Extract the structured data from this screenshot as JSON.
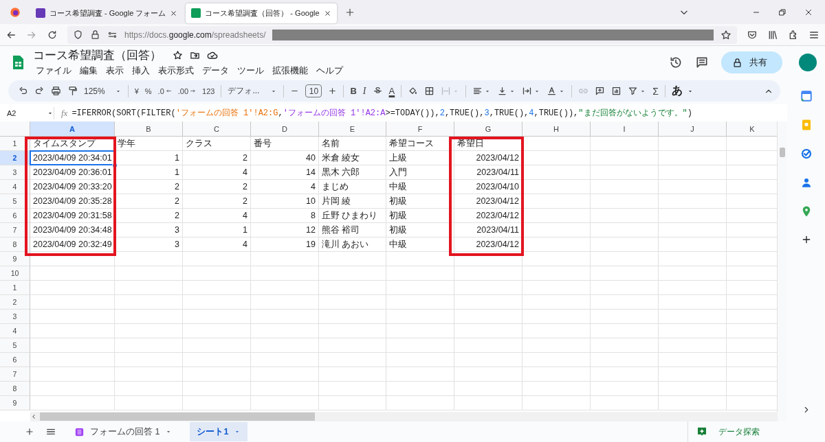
{
  "browser": {
    "tabs": [
      {
        "title": "コース希望調査 - Google フォーム",
        "kind": "form",
        "selected": false
      },
      {
        "title": "コース希望調査（回答） - Google",
        "kind": "sheet",
        "selected": true
      }
    ],
    "url": "https://docs.**google.com**/spreadsheets/"
  },
  "document": {
    "title": "コース希望調査（回答）",
    "menu": [
      "ファイル",
      "編集",
      "表示",
      "挿入",
      "表示形式",
      "データ",
      "ツール",
      "拡張機能",
      "ヘルプ"
    ],
    "share": "共有"
  },
  "toolbar": {
    "zoom": "125%",
    "currency": "¥",
    "percent": "%",
    "decrease_decimal": ".0",
    "increase_decimal": ".00",
    "number_format": "123",
    "font": "デフォ...",
    "font_size": "10",
    "bold": "B",
    "italic": "I",
    "text_color": "A",
    "merge": {
      "disabled": true
    },
    "link": {
      "disabled": true
    },
    "sum": "Σ",
    "input_tools": "あ"
  },
  "formula_bar": {
    "cell": "A2",
    "fx": "fx",
    "formula": [
      {
        "text": "=IFERROR(SORT(FILTER("
      },
      {
        "text": "'フォームの回答 1'!A2:G",
        "color": "#e8710a"
      },
      {
        "text": ","
      },
      {
        "text": "'フォームの回答 1'!A2:A",
        "color": "#9334e6"
      },
      {
        "text": ">=TODAY()),"
      },
      {
        "text": "2",
        "color": "#1a73e8"
      },
      {
        "text": ",TRUE(),"
      },
      {
        "text": "3",
        "color": "#1a73e8"
      },
      {
        "text": ",TRUE(),"
      },
      {
        "text": "4",
        "color": "#1a73e8"
      },
      {
        "text": ",TRUE()),"
      },
      {
        "text": "\"まだ回答がないようです。\"",
        "color": "#188038"
      },
      {
        "text": ")"
      }
    ]
  },
  "grid": {
    "columns": [
      {
        "letter": "A",
        "selected": true,
        "highlighted": true
      },
      {
        "letter": "B",
        "selected": false,
        "highlighted": false
      },
      {
        "letter": "C",
        "selected": false,
        "highlighted": false
      },
      {
        "letter": "D",
        "selected": false,
        "highlighted": false
      },
      {
        "letter": "E",
        "selected": false,
        "highlighted": false
      },
      {
        "letter": "F",
        "selected": false,
        "highlighted": false
      },
      {
        "letter": "G",
        "selected": false,
        "highlighted": true
      },
      {
        "letter": "H",
        "selected": false
      },
      {
        "letter": "I",
        "selected": false
      },
      {
        "letter": "J",
        "selected": false
      },
      {
        "letter": "K",
        "selected": false
      }
    ],
    "rows": [
      {
        "label": "1",
        "kind": "header",
        "selected": false,
        "cells": [
          "タイムスタンプ",
          "学年",
          "クラス",
          "番号",
          "名前",
          "希望コース",
          "希望日"
        ]
      },
      {
        "label": "2",
        "kind": "data",
        "selected": true,
        "cells": [
          "2023/04/09 20:34:01",
          "1",
          "2",
          "40",
          "米倉 綾女",
          "上級",
          "2023/04/12"
        ]
      },
      {
        "label": "3",
        "kind": "data",
        "selected": false,
        "cells": [
          "2023/04/09 20:36:01",
          "1",
          "4",
          "14",
          "黒木 六郎",
          "入門",
          "2023/04/11"
        ]
      },
      {
        "label": "4",
        "kind": "data",
        "selected": false,
        "cells": [
          "2023/04/09 20:33:20",
          "2",
          "2",
          "4",
          "まじめ",
          "中級",
          "2023/04/10"
        ]
      },
      {
        "label": "5",
        "kind": "data",
        "selected": false,
        "cells": [
          "2023/04/09 20:35:28",
          "2",
          "2",
          "10",
          "片岡 綾",
          "初級",
          "2023/04/12"
        ]
      },
      {
        "label": "6",
        "kind": "data",
        "selected": false,
        "cells": [
          "2023/04/09 20:31:58",
          "2",
          "4",
          "8",
          "丘野 ひまわり",
          "初級",
          "2023/04/12"
        ]
      },
      {
        "label": "7",
        "kind": "data",
        "selected": false,
        "cells": [
          "2023/04/09 20:34:48",
          "3",
          "1",
          "12",
          "熊谷 裕司",
          "初級",
          "2023/04/11"
        ]
      },
      {
        "label": "8",
        "kind": "data",
        "selected": false,
        "cells": [
          "2023/04/09 20:32:49",
          "3",
          "4",
          "19",
          "滝川 あおい",
          "中級",
          "2023/04/12"
        ]
      },
      {
        "label": "9",
        "selected": false
      },
      {
        "label": "10",
        "selected": false
      },
      {
        "label": "1",
        "selected": false
      },
      {
        "label": "2",
        "selected": false
      },
      {
        "label": "3",
        "selected": false
      },
      {
        "label": "4",
        "selected": false
      },
      {
        "label": "5",
        "selected": false
      },
      {
        "label": "6",
        "selected": false
      },
      {
        "label": "7",
        "selected": false
      },
      {
        "label": "8",
        "selected": false
      },
      {
        "label": "9",
        "selected": false
      }
    ]
  },
  "sheet_tabs": [
    {
      "label": "フォームの回答 1",
      "kind": "form",
      "selected": false
    },
    {
      "label": "シート1",
      "kind": "sheet",
      "selected": true
    }
  ],
  "explore": "データ探索"
}
